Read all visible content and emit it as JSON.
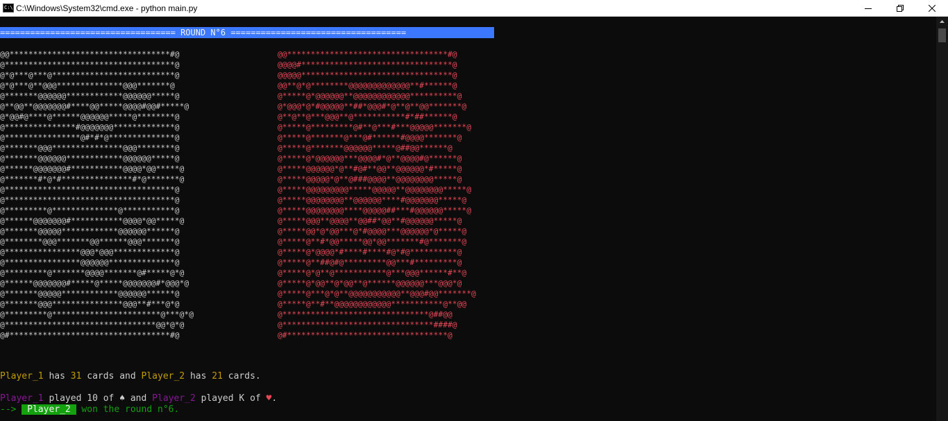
{
  "window": {
    "title": "C:\\Windows\\System32\\cmd.exe - python  main.py",
    "icon_text": "C:\\"
  },
  "round_banner": "=================================== ROUND N°6 ===================================",
  "left_card_art": [
    "@@**********************************#@",
    "@************************************@",
    "@*@***@***@**************************@",
    "@*@***@**@@@**************@@@*******@",
    "@*******@@@@@@************@@@@@@*****@",
    "@**@@**@@@@@@@#****@@*****@@@@#@@#*****@",
    "@*@@#@****@******@@@@@@*****@********@",
    "@***************#@@@@@@@*************@",
    "@****************@#*#*@**************@",
    "@*******@@@***************@@@********@",
    "@*******@@@@@@************@@@@@@*****@",
    "@******@@@@@@@#***********@@@@*@@*****@",
    "@*******#*@*#***************#*@*******@",
    "@************************************@",
    "@************************************@",
    "@*********@**************@***********@",
    "@******@@@@@@@#***********@@@@*@@*****@",
    "@*******@@@@@************@@@@@@******@",
    "@********@@@*******@@******@@@*******@",
    "@****************@@@*@@@*************@",
    "@****************@@@@@@**************@",
    "@*********@*******@@@@*******@#*****@*@",
    "@******@@@@@@@#*****@*****@@@@@@@#*@@@*@",
    "@*******@@@@@************@@@@@@******@",
    "@*******@@@***************@@@**#***@*@",
    "@*********@***********************@***@*@",
    "@********************************@@*@*@",
    "@#**********************************#@"
  ],
  "right_card_art": [
    "@@**********************************#@",
    "@@@@#********************************@",
    "@@@@@********************************@",
    "@@**@*@********@@@@@@@@@@@@@**#******@",
    "@*****@*@@@@@@**@@@@@@@@@@@@**********@",
    "@*@@@*@*#@@@@@**##*@@@#*@**@**@@*******@",
    "@**@**@***@@@**@***********#*##******@",
    "@*****@*********@#**@***#***@@@@@*******@",
    "@*****@*******@***@#******#@@@@*******@",
    "@*****@*******@@@@@@*****@##@@******@",
    "@*****@*@@@@@@***@@@@#*@**@@@@#@******@",
    "@*****@@@@@@*@**#@#**@@**@@@@@@*#*****@",
    "@*****@@@@@*@**@###@@@@**@@@@@@@@*****@",
    "@*****@@@@@@@@@*****@@@@@**@@@@@@@@*****@",
    "@*****@@@@@@@@**@@@@@@****#@@@@@@@*****@",
    "@*****@@@@@@@@****@@@@@##***#@@@@@@*****@",
    "@*****@@@**@@@@**@@##*@@**#@@@@@@*****@",
    "@*****@@*@*@@***@*#@@@@***@@@@@@*@*****@",
    "@*****@**#*@@*****@@*@@*******#@*******@",
    "@*****@*@@@@*#****#****#@*#@**********@",
    "@*****@**##@#@*********@@***#*********@",
    "@*****@*@**@***********@***@@@******#**@",
    "@*****@*@@**@*@@**@******@@@@@@***@@@*@",
    "@*****@***@*@**@@@@@@@@@@@**@@@#@@*******@",
    "@*****@**#**@@@@@@@@@@@@***********@**@@",
    "@*******************************@##@@",
    "@********************************####@",
    "@#**********************************@"
  ],
  "status_line": {
    "player1": "Player_1",
    "has1": " has ",
    "count1": "31",
    "mid": " cards and ",
    "player2": "Player_2",
    "has2": " has ",
    "count2": "21",
    "end": " cards."
  },
  "play_line": {
    "player1": "Player_1",
    "played1": " played 10 of ",
    "suit1": "♠",
    "and": " and ",
    "player2": "Player_2",
    "played2": " played K of ",
    "suit2": "♥",
    "end": "."
  },
  "result_line": {
    "arrow": "--> ",
    "winner": " Player_2 ",
    "text": " won the round n°6."
  },
  "colors": {
    "background": "#0c0c0c",
    "text": "#cccccc",
    "banner": "#3b78ff",
    "yellow": "#c19c00",
    "purple": "#881798",
    "red": "#e74856",
    "green": "#13a10e"
  },
  "icons": [
    "cmd-icon",
    "minimize-icon",
    "maximize-icon",
    "close-icon",
    "scroll-up-icon"
  ]
}
